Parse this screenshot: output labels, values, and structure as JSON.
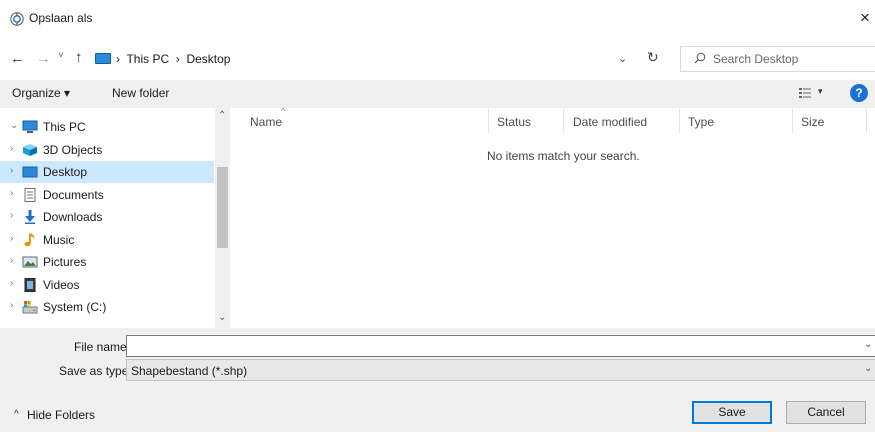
{
  "window": {
    "title": "Opslaan als",
    "close_glyph": "×"
  },
  "toolbar": {
    "back_glyph": "←",
    "forward_glyph": "→",
    "recent_glyph": "˅",
    "up_glyph": "↑",
    "address": "›  This PC  ›  Desktop",
    "address_dropdown_glyph": "⌄",
    "refresh_glyph": "↻",
    "search_placeholder": "Search Desktop"
  },
  "commandbar": {
    "organize_label": "Organize ▾",
    "new_folder_label": "New folder",
    "view_arrow": "▾",
    "help_label": "?"
  },
  "navpane": {
    "items": [
      {
        "chevron": "⌄",
        "label": "This PC",
        "icon": "pc-icon",
        "selected": false
      },
      {
        "chevron": "›",
        "label": "3D Objects",
        "icon": "3d-objects-icon",
        "selected": false
      },
      {
        "chevron": "›",
        "label": "Desktop",
        "icon": "desktop-icon",
        "selected": true
      },
      {
        "chevron": "›",
        "label": "Documents",
        "icon": "documents-icon",
        "selected": false
      },
      {
        "chevron": "›",
        "label": "Downloads",
        "icon": "downloads-icon",
        "selected": false
      },
      {
        "chevron": "›",
        "label": "Music",
        "icon": "music-icon",
        "selected": false
      },
      {
        "chevron": "›",
        "label": "Pictures",
        "icon": "pictures-icon",
        "selected": false
      },
      {
        "chevron": "›",
        "label": "Videos",
        "icon": "videos-icon",
        "selected": false
      },
      {
        "chevron": "›",
        "label": "System (C:)",
        "icon": "drive-icon",
        "selected": false
      }
    ],
    "scroll_up_glyph": "⌃",
    "scroll_down_glyph": "⌄"
  },
  "content": {
    "columns": [
      "Name",
      "Status",
      "Date modified",
      "Type",
      "Size"
    ],
    "sort_glyph": "^",
    "empty_message": "No items match your search."
  },
  "form": {
    "file_name_label": "File name:",
    "file_name_value": "",
    "file_name_arrow": "⌄",
    "save_type_label": "Save as type:",
    "save_type_value": "Shapebestand (*.shp)",
    "save_type_arrow": "⌄"
  },
  "footer": {
    "hide_folders_glyph": "^",
    "hide_folders_label": "Hide Folders",
    "save_label": "Save",
    "cancel_label": "Cancel"
  },
  "colors": {
    "selection": "#cce8ff",
    "accent": "#0078d7",
    "panel": "#f0f0f0"
  }
}
